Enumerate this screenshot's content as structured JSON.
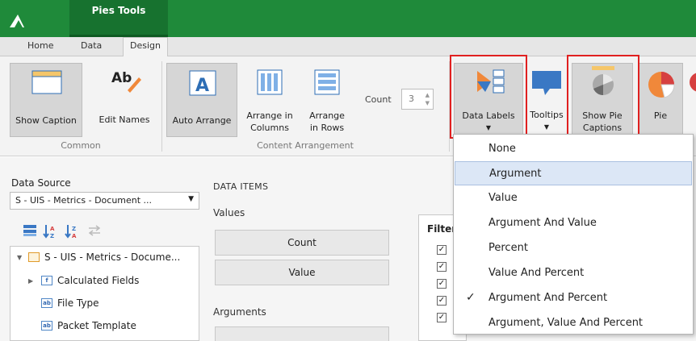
{
  "title_bar": {
    "context_tab": "Pies Tools"
  },
  "tabs": [
    {
      "label": "Home"
    },
    {
      "label": "Data"
    },
    {
      "label": "Design",
      "active": true
    }
  ],
  "ribbon": {
    "groups": [
      {
        "label": "Common"
      },
      {
        "label": "Content Arrangement"
      }
    ],
    "buttons": {
      "show_caption": "Show Caption",
      "edit_names": "Edit Names",
      "auto_arrange": "Auto Arrange",
      "arrange_columns_1": "Arrange in",
      "arrange_columns_2": "Columns",
      "arrange_rows_1": "Arrange",
      "arrange_rows_2": "in Rows",
      "data_labels": "Data Labels",
      "tooltips": "Tooltips",
      "show_pie_captions_1": "Show Pie",
      "show_pie_captions_2": "Captions",
      "pie": "Pie"
    },
    "count": {
      "label": "Count",
      "value": "3"
    }
  },
  "data_source": {
    "label": "Data Source",
    "selected": "S - UIS - Metrics - Document ..."
  },
  "tree": {
    "root": "S - UIS - Metrics - Docume...",
    "items": [
      "Calculated Fields",
      "File Type",
      "Packet Template"
    ]
  },
  "data_items": {
    "title": "DATA ITEMS",
    "values_label": "Values",
    "values": [
      "Count",
      "Value"
    ],
    "arguments_label": "Arguments"
  },
  "filter": {
    "title": "Filter"
  },
  "data_labels_menu": {
    "items": [
      {
        "label": "None"
      },
      {
        "label": "Argument",
        "highlighted": true
      },
      {
        "label": "Value"
      },
      {
        "label": "Argument And Value"
      },
      {
        "label": "Percent"
      },
      {
        "label": "Value And Percent"
      },
      {
        "label": "Argument And Percent",
        "checked": true
      },
      {
        "label": "Argument, Value And Percent"
      }
    ],
    "check_glyph": "✓"
  },
  "colors": {
    "title_bar": "#1f8a3a",
    "context_tab": "#17722f",
    "highlight_box": "#e02020",
    "menu_hover": "#dce7f6"
  }
}
